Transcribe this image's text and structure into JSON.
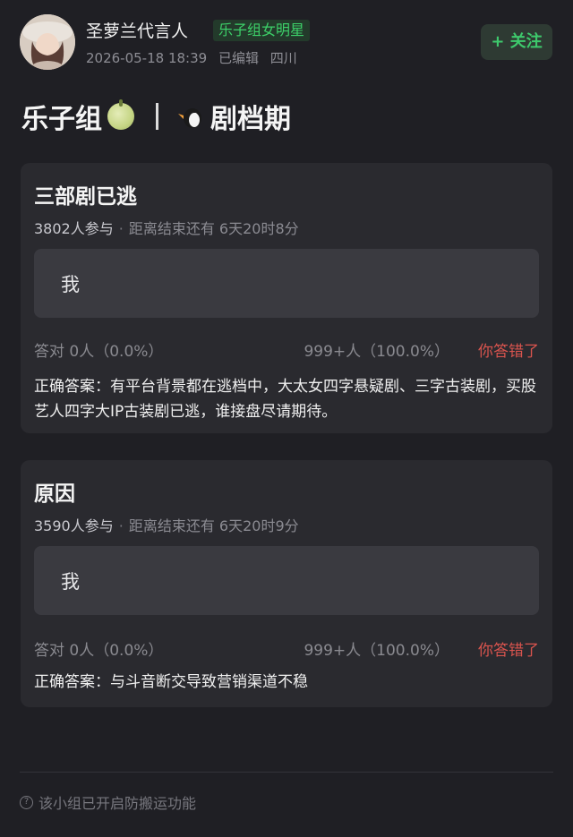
{
  "header": {
    "username": "圣萝兰代言人",
    "group_badge": "乐子组女明星",
    "datetime": "2026-05-18 18:39",
    "edited": "已编辑",
    "location": "四川",
    "follow_label": "+ 关注"
  },
  "title": {
    "group_name": "乐子组",
    "topic": "剧档期"
  },
  "polls": [
    {
      "title": "三部剧已逃",
      "participants": "3802人参与",
      "deadline": "距离结束还有 6天20时8分",
      "option": "我",
      "correct_count": "答对  0人（0.0%）",
      "wrong_count": "999+人（100.0%）",
      "result": "你答错了",
      "answer": "正确答案：有平台背景都在逃档中，大太女四字悬疑剧、三字古装剧，买股艺人四字大IP古装剧已逃，谁接盘尽请期待。"
    },
    {
      "title": "原因",
      "participants": "3590人参与",
      "deadline": "距离结束还有 6天20时9分",
      "option": "我",
      "correct_count": "答对  0人（0.0%）",
      "wrong_count": "999+人（100.0%）",
      "result": "你答错了",
      "answer": "正确答案：与斗音断交导致营销渠道不稳"
    }
  ],
  "footer": {
    "note": "该小组已开启防搬运功能"
  },
  "colors": {
    "background": "#1f1f24",
    "card": "#2a2a2f",
    "option": "#3a3a40",
    "accent_green": "#3ec96c",
    "wrong_red": "#d9544e"
  }
}
